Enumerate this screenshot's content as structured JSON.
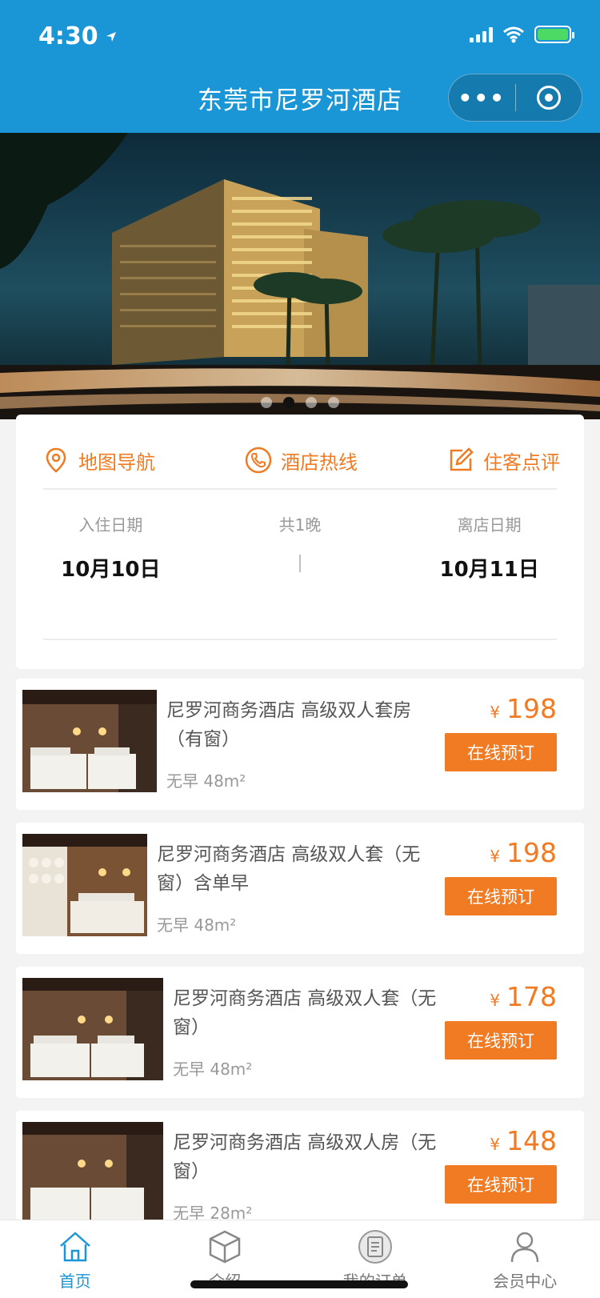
{
  "status": {
    "time": "4:30"
  },
  "header": {
    "title": "东莞市尼罗河酒店",
    "more_glyph": "•••"
  },
  "banner": {
    "dots": 4,
    "active_dot": 1
  },
  "quick_actions": [
    {
      "label": "地图导航",
      "icon": "map-pin-icon"
    },
    {
      "label": "酒店热线",
      "icon": "phone-icon"
    },
    {
      "label": "住客点评",
      "icon": "edit-icon"
    }
  ],
  "dates": {
    "checkin_label": "入住日期",
    "checkin_value": "10月10日",
    "nights_label": "共1晚",
    "divider": "|",
    "checkout_label": "离店日期",
    "checkout_value": "10月11日"
  },
  "rooms": [
    {
      "name": "尼罗河商务酒店 高级双人套房（有窗）",
      "meta": "无早 48m²",
      "currency": "¥",
      "price": "198",
      "book": "在线预订"
    },
    {
      "name": "尼罗河商务酒店 高级双人套（无窗）含单早",
      "meta": "无早 48m²",
      "currency": "¥",
      "price": "198",
      "book": "在线预订"
    },
    {
      "name": "尼罗河商务酒店 高级双人套（无窗）",
      "meta": "无早 48m²",
      "currency": "¥",
      "price": "178",
      "book": "在线预订"
    },
    {
      "name": "尼罗河商务酒店 高级双人房（无窗）",
      "meta": "无早 28m²",
      "currency": "¥",
      "price": "148",
      "book": "在线预订"
    }
  ],
  "tabs": [
    {
      "label": "首页",
      "icon": "home-icon",
      "active": true
    },
    {
      "label": "介绍",
      "icon": "cube-icon",
      "active": false
    },
    {
      "label": "我的订单",
      "icon": "order-list-icon",
      "active": false
    },
    {
      "label": "会员中心",
      "icon": "user-icon",
      "active": false
    }
  ],
  "colors": {
    "brand": "#1a96d6",
    "accent": "#f07b22"
  }
}
